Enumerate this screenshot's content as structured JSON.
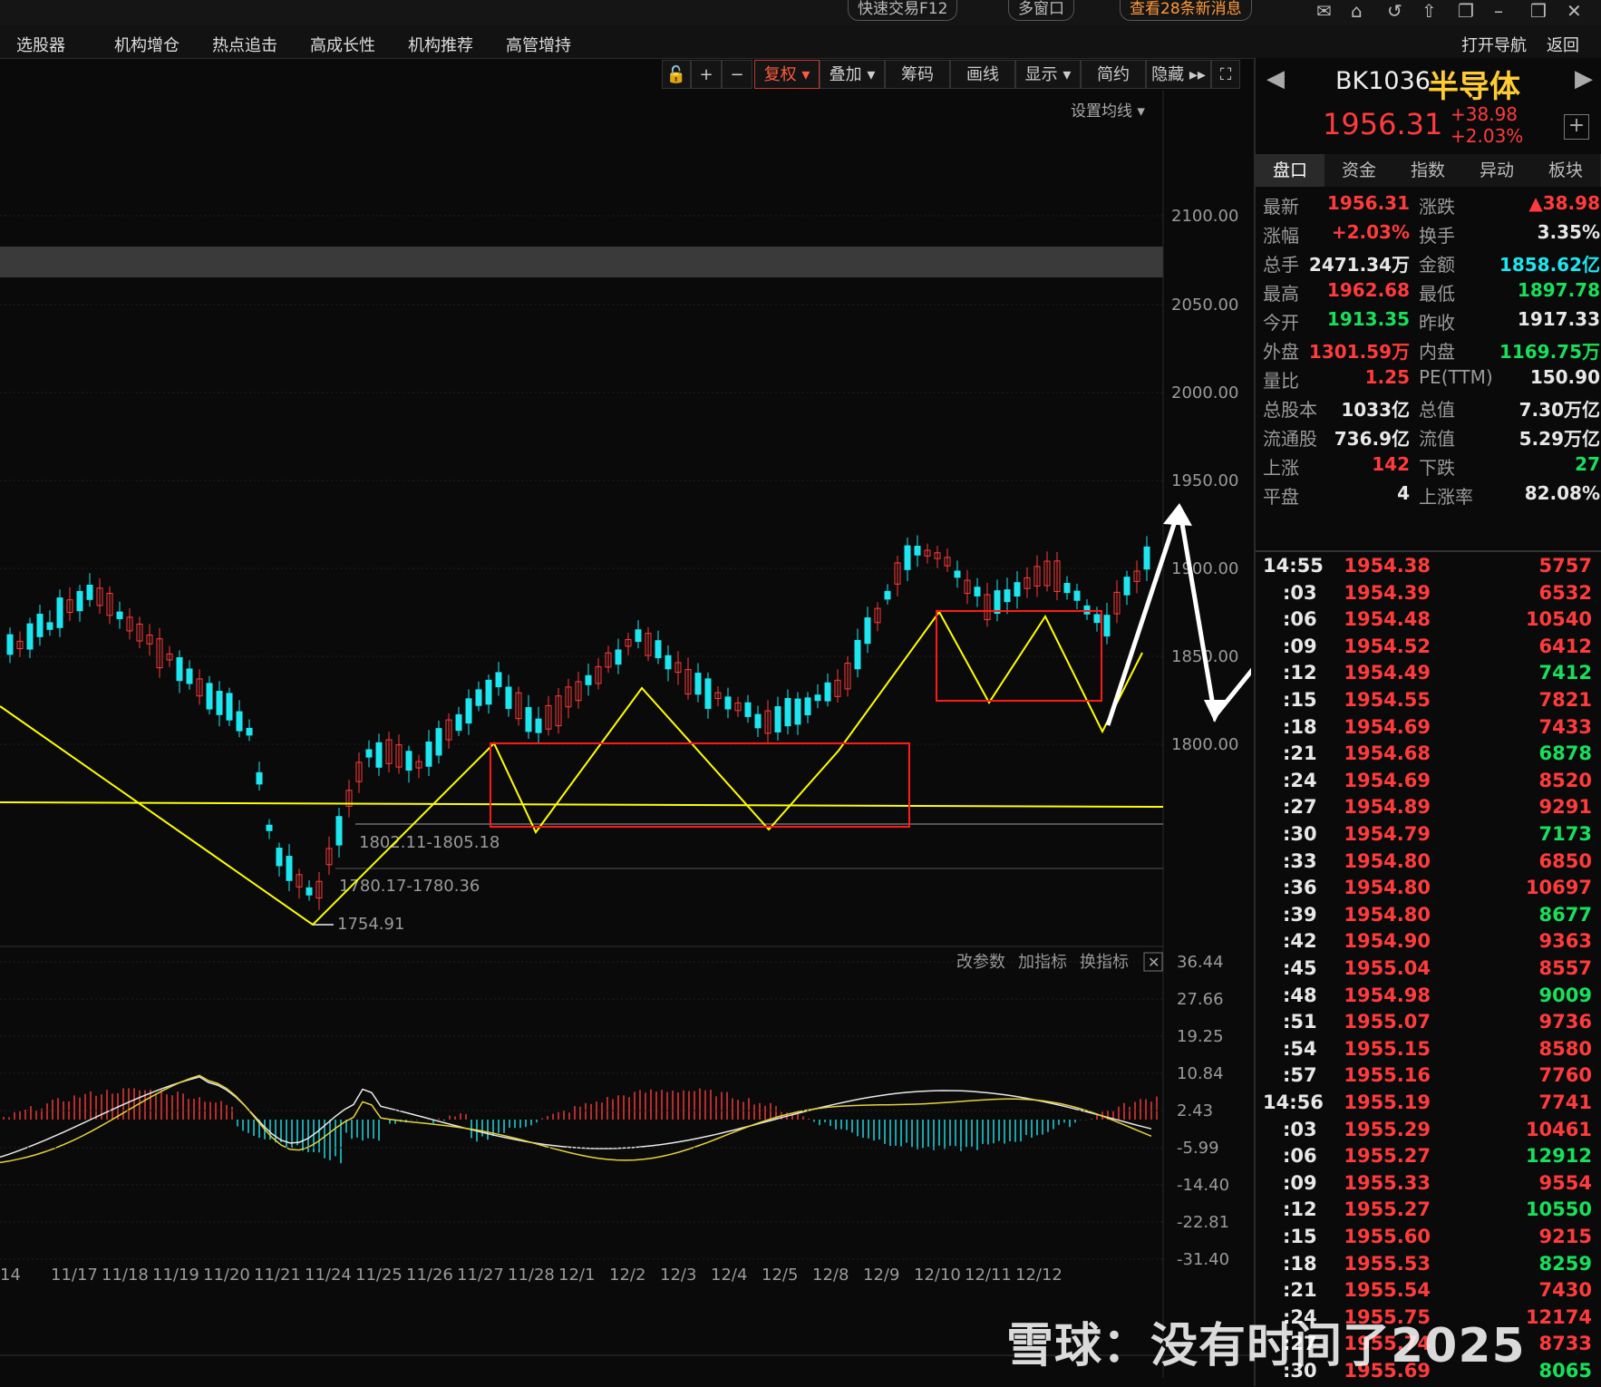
{
  "topbar": {
    "quick_trade": "快速交易F12",
    "multi_window": "多窗口",
    "messages": "查看28条新消息"
  },
  "nav": {
    "items": [
      "选股器",
      "机构增仓",
      "热点追击",
      "高成长性",
      "机构推荐",
      "高管增持"
    ],
    "open_nav": "打开导航",
    "back": "返回"
  },
  "toolbar": {
    "buttons": [
      "复权",
      "叠加",
      "筹码",
      "画线",
      "显示",
      "简约",
      "隐藏"
    ],
    "ma_settings": "设置均线"
  },
  "chart": {
    "price_ticks": [
      "2100.00",
      "2050.00",
      "2000.00",
      "1950.00",
      "1900.00",
      "1850.00",
      "1800.00"
    ],
    "annotations": [
      "1802.11-1805.18",
      "1780.17-1780.36",
      "1754.91"
    ],
    "indicator_buttons": [
      "改参数",
      "加指标",
      "换指标"
    ],
    "macd_ticks": [
      "36.44",
      "27.66",
      "19.25",
      "10.84",
      "2.43",
      "-5.99",
      "-14.40",
      "-22.81",
      "-31.40"
    ],
    "dates": [
      "14",
      "11/17",
      "11/18",
      "11/19",
      "11/20",
      "11/21",
      "11/24",
      "11/25",
      "11/26",
      "11/27",
      "11/28",
      "12/1",
      "12/2",
      "12/3",
      "12/4",
      "12/5",
      "12/8",
      "12/9",
      "12/10",
      "12/11",
      "12/12"
    ],
    "colors": {
      "up": "#ff3b3b",
      "down": "#1ee6f0",
      "zigzag": "#ffff00",
      "box": "#ff1a1a"
    }
  },
  "quote": {
    "code": "BK1036",
    "name": "半导体",
    "price": "1956.31",
    "change": "+38.98",
    "change_pct": "+2.03%",
    "tabs": [
      "盘口",
      "资金",
      "指数",
      "异动",
      "板块"
    ],
    "rows": [
      [
        "最新",
        "1956.31",
        "涨跌",
        "▲38.98"
      ],
      [
        "涨幅",
        "+2.03%",
        "换手",
        "3.35%"
      ],
      [
        "总手",
        "2471.34万",
        "金额",
        "1858.62亿"
      ],
      [
        "最高",
        "1962.68",
        "最低",
        "1897.78"
      ],
      [
        "今开",
        "1913.35",
        "昨收",
        "1917.33"
      ],
      [
        "外盘",
        "1301.59万",
        "内盘",
        "1169.75万"
      ],
      [
        "量比",
        "1.25",
        "PE(TTM)",
        "150.90"
      ],
      [
        "总股本",
        "1033亿",
        "总值",
        "7.30万亿"
      ],
      [
        "流通股",
        "736.9亿",
        "流值",
        "5.29万亿"
      ],
      [
        "上涨",
        "142",
        "下跌",
        "27"
      ],
      [
        "平盘",
        "4",
        "上涨率",
        "82.08%"
      ]
    ]
  },
  "ticks": [
    [
      "14:55",
      "1954.38",
      "5757",
      "r"
    ],
    [
      ":03",
      "1954.39",
      "6532",
      "r"
    ],
    [
      ":06",
      "1954.48",
      "10540",
      "r"
    ],
    [
      ":09",
      "1954.52",
      "6412",
      "r"
    ],
    [
      ":12",
      "1954.49",
      "7412",
      "g"
    ],
    [
      ":15",
      "1954.55",
      "7821",
      "r"
    ],
    [
      ":18",
      "1954.69",
      "7433",
      "r"
    ],
    [
      ":21",
      "1954.68",
      "6878",
      "g"
    ],
    [
      ":24",
      "1954.69",
      "8520",
      "r"
    ],
    [
      ":27",
      "1954.89",
      "9291",
      "r"
    ],
    [
      ":30",
      "1954.79",
      "7173",
      "g"
    ],
    [
      ":33",
      "1954.80",
      "6850",
      "r"
    ],
    [
      ":36",
      "1954.80",
      "10697",
      "r"
    ],
    [
      ":39",
      "1954.80",
      "8677",
      "g"
    ],
    [
      ":42",
      "1954.90",
      "9363",
      "r"
    ],
    [
      ":45",
      "1955.04",
      "8557",
      "r"
    ],
    [
      ":48",
      "1954.98",
      "9009",
      "g"
    ],
    [
      ":51",
      "1955.07",
      "9736",
      "r"
    ],
    [
      ":54",
      "1955.15",
      "8580",
      "r"
    ],
    [
      ":57",
      "1955.16",
      "7760",
      "r"
    ],
    [
      "14:56",
      "1955.19",
      "7741",
      "r"
    ],
    [
      ":03",
      "1955.29",
      "10461",
      "r"
    ],
    [
      ":06",
      "1955.27",
      "12912",
      "g"
    ],
    [
      ":09",
      "1955.33",
      "9554",
      "r"
    ],
    [
      ":12",
      "1955.27",
      "10550",
      "g"
    ],
    [
      ":15",
      "1955.60",
      "9215",
      "r"
    ],
    [
      ":18",
      "1955.53",
      "8259",
      "g"
    ],
    [
      ":21",
      "1955.54",
      "7430",
      "r"
    ],
    [
      ":24",
      "1955.75",
      "12174",
      "r"
    ],
    [
      ":27",
      "1955.74",
      "8733",
      "r"
    ],
    [
      ":30",
      "1955.69",
      "8065",
      "g"
    ]
  ],
  "watermark": "雪球：没有时间了2025"
}
